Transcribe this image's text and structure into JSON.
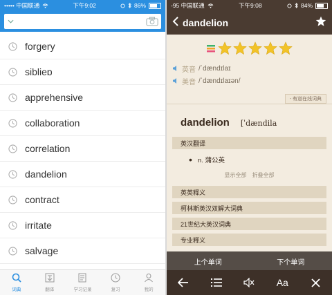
{
  "left": {
    "status": {
      "carrier": "••••• 中国联通",
      "time": "下午9:02",
      "battery": "86%",
      "battery_level": 0.86
    },
    "search": {
      "placeholder": "",
      "value": ""
    },
    "words": [
      "forgery",
      "siblieɒ",
      "apprehensive",
      "collaboration",
      "correlation",
      "dandelion",
      "contract",
      "irritate",
      "salvage"
    ],
    "tabs": [
      {
        "label": "词典",
        "icon": "search-icon",
        "active": true
      },
      {
        "label": "翻译",
        "icon": "translate-icon",
        "active": false
      },
      {
        "label": "学习记录",
        "icon": "document-icon",
        "active": false
      },
      {
        "label": "复习",
        "icon": "clock-icon",
        "active": false
      },
      {
        "label": "我的",
        "icon": "person-icon",
        "active": false
      }
    ]
  },
  "right": {
    "status": {
      "carrier": "-95 中国联通",
      "time": "下午9:08",
      "battery": "84%",
      "battery_level": 0.84
    },
    "header": {
      "title": "dandelion"
    },
    "stars": 5,
    "pronunciations": [
      {
        "label": "英音",
        "ipa": "/ˈdændɪlaɪ"
      },
      {
        "label": "美音",
        "ipa": "/ˈdændɪlaɪən/"
      }
    ],
    "youdao_tag": "- 有道在线词典",
    "headword": "dandelion",
    "headword_phonetic": "[ˈdændila",
    "sections": {
      "en_cn": "英汉翻译",
      "en_en": "英英释义",
      "collins": "柯林斯英汉双解大词典",
      "century": "21世纪大英汉词典",
      "extra": "专业释义"
    },
    "definition": "n. 蒲公英",
    "show_all": "显示全部",
    "collapse_all": "折叠全部",
    "prev_word": "上个单词",
    "next_word": "下个单词",
    "font_button": "Aa",
    "colors": {
      "left_accent": "#2b8fe0",
      "right_header": "#4a3b31",
      "star": "#f2c328"
    }
  }
}
